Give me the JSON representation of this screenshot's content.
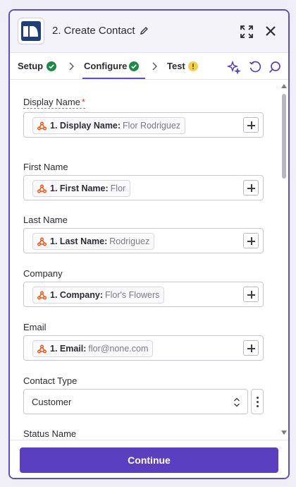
{
  "header": {
    "title": "2. Create Contact",
    "logo_icon": "app-logo-icon",
    "edit_icon": "pencil-icon",
    "expand_icon": "expand-icon",
    "close_icon": "close-icon"
  },
  "tabs": [
    {
      "label": "Setup",
      "status": "complete"
    },
    {
      "label": "Configure",
      "status": "complete",
      "active": true
    },
    {
      "label": "Test",
      "status": "warning"
    }
  ],
  "toolbar": {
    "icons": [
      "sparkle-icon",
      "refresh-icon",
      "search-icon"
    ]
  },
  "fields": {
    "display_name": {
      "label": "Display Name",
      "required_mark": "*",
      "pill_key": "1. Display Name:",
      "pill_value": "Flor Rodriguez"
    },
    "first_name": {
      "label": "First Name",
      "pill_key": "1. First Name:",
      "pill_value": "Flor"
    },
    "last_name": {
      "label": "Last Name",
      "pill_key": "1. Last Name:",
      "pill_value": "Rodriguez"
    },
    "company": {
      "label": "Company",
      "pill_key": "1. Company:",
      "pill_value": "Flor's Flowers"
    },
    "email": {
      "label": "Email",
      "pill_key": "1. Email:",
      "pill_value": "flor@none.com"
    },
    "contact_type": {
      "label": "Contact Type",
      "value": "Customer"
    },
    "status_name": {
      "label": "Status Name"
    }
  },
  "footer": {
    "continue_label": "Continue"
  },
  "colors": {
    "accent": "#5a3fc0",
    "success": "#1e8a4a",
    "warning": "#f4d04a",
    "webhook": "#ff4a00"
  }
}
